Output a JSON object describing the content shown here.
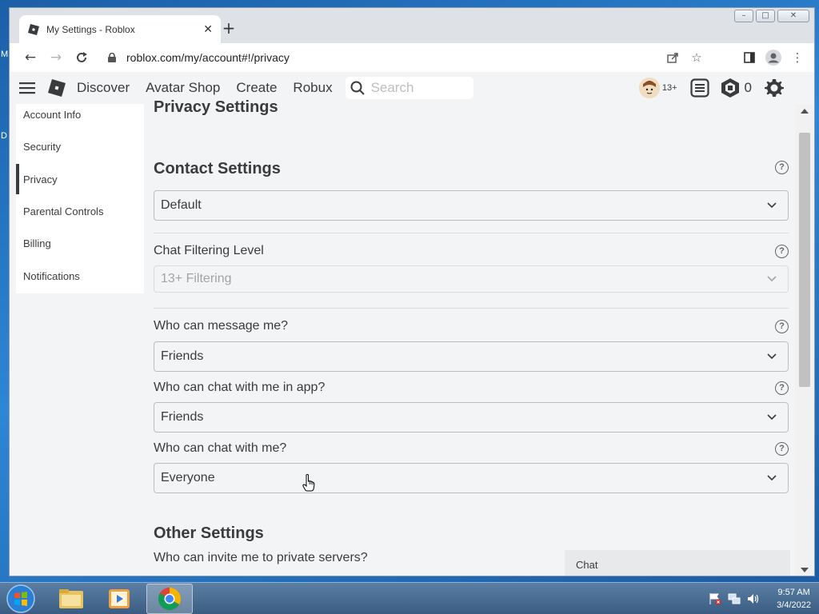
{
  "desktop": {
    "edge_letters": [
      "M",
      "D"
    ]
  },
  "browser": {
    "tab": {
      "title": "My Settings - Roblox",
      "favicon": "roblox-icon"
    },
    "new_tab_symbol": "+",
    "url": "roblox.com/my/account#!/privacy",
    "window_controls": [
      "minimize",
      "maximize",
      "close"
    ]
  },
  "roblox_header": {
    "nav": [
      "Discover",
      "Avatar Shop",
      "Create",
      "Robux"
    ],
    "search_placeholder": "Search",
    "age_badge": "13+",
    "robux_balance": "0"
  },
  "sidebar": {
    "items": [
      {
        "label": "Account Info",
        "active": false
      },
      {
        "label": "Security",
        "active": false
      },
      {
        "label": "Privacy",
        "active": true
      },
      {
        "label": "Parental Controls",
        "active": false
      },
      {
        "label": "Billing",
        "active": false
      },
      {
        "label": "Notifications",
        "active": false
      }
    ]
  },
  "privacy": {
    "page_title": "Privacy Settings",
    "contact_heading": "Contact Settings",
    "contact_value": "Default",
    "chat_filter_label": "Chat Filtering Level",
    "chat_filter_value": "13+ Filtering",
    "message_label": "Who can message me?",
    "message_value": "Friends",
    "chat_app_label": "Who can chat with me in app?",
    "chat_app_value": "Friends",
    "chat_label": "Who can chat with me?",
    "chat_value": "Everyone",
    "other_heading": "Other Settings",
    "invite_label": "Who can invite me to private servers?",
    "help_symbol": "?"
  },
  "chat_widget": {
    "label": "Chat"
  },
  "taskbar": {
    "time": "9:57 AM",
    "date": "3/4/2022"
  },
  "colors": {
    "roblox_text": "#393b3d",
    "page_bg": "#f2f4f5",
    "chrome_frame": "#dee1e6",
    "taskbar": "#3a5c82"
  }
}
